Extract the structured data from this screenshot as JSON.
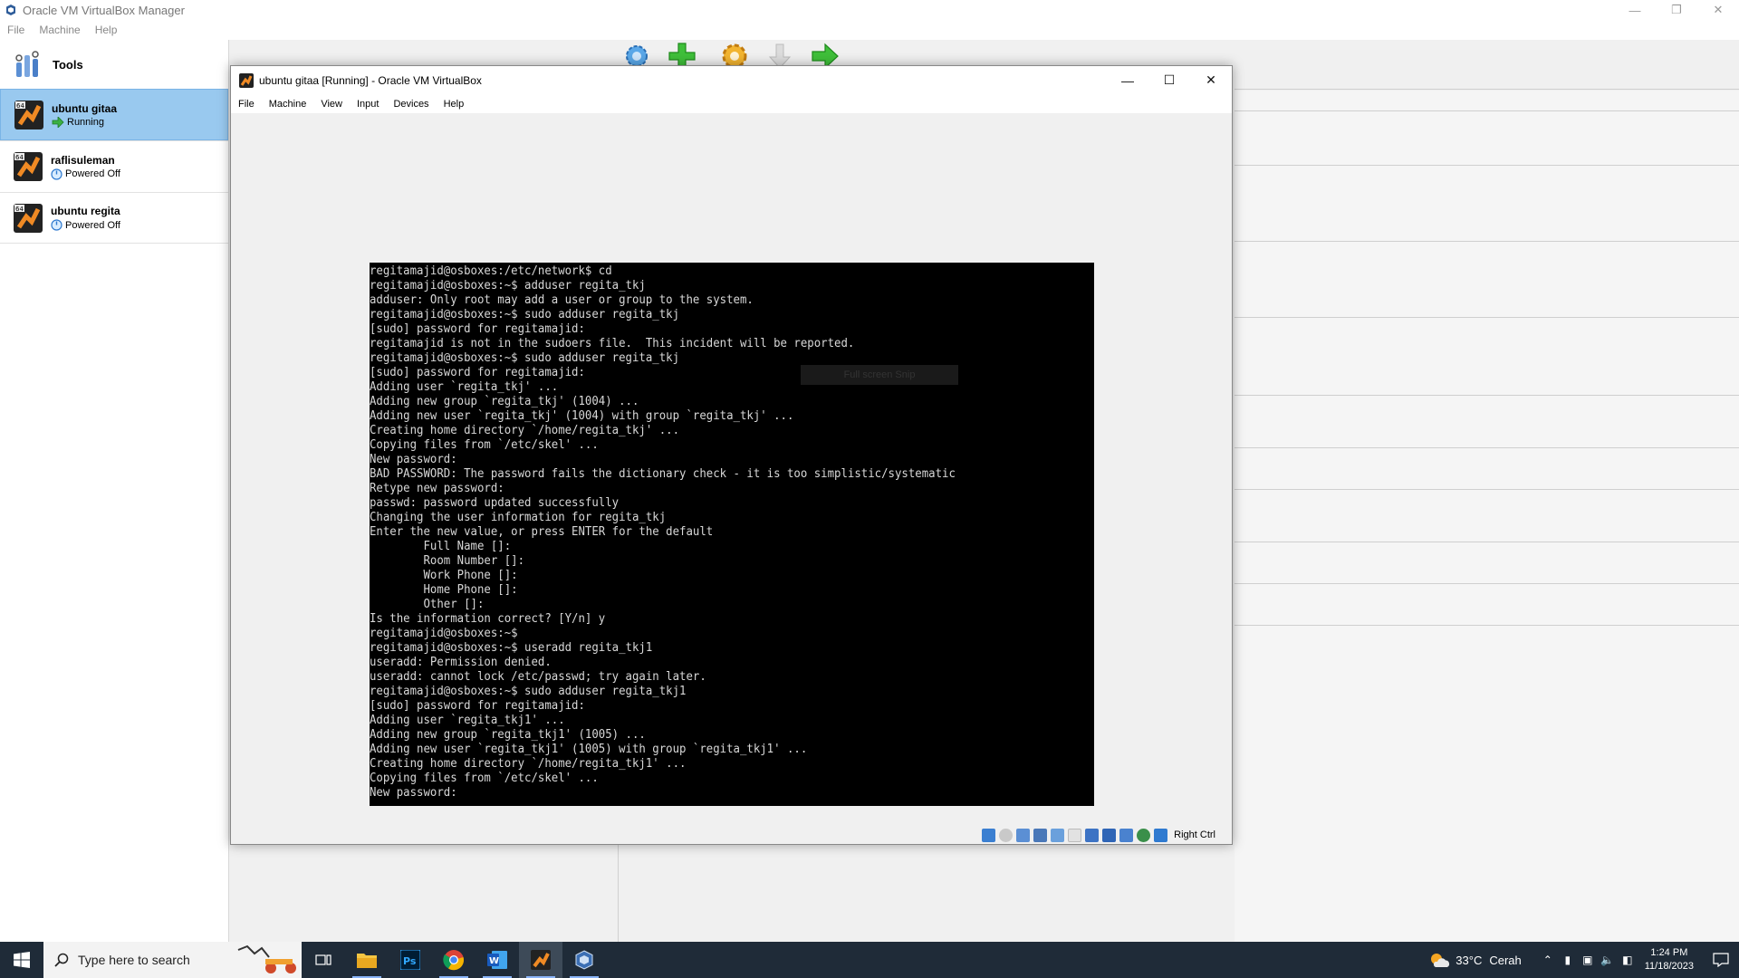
{
  "manager": {
    "title": "Oracle VM VirtualBox Manager",
    "menu": [
      "File",
      "Machine",
      "Help"
    ],
    "tools_label": "Tools",
    "vms": [
      {
        "name": "ubuntu gitaa",
        "state": "Running",
        "selected": true
      },
      {
        "name": "raflisuleman",
        "state": "Powered Off",
        "selected": false
      },
      {
        "name": "ubuntu regita",
        "state": "Powered Off",
        "selected": false
      }
    ],
    "toolbar_icons": [
      "preferences-icon",
      "new-vm-icon",
      "settings-icon",
      "discard-icon",
      "start-icon"
    ]
  },
  "vm_window": {
    "title": "ubuntu gitaa [Running] - Oracle VM VirtualBox",
    "menu": [
      "File",
      "Machine",
      "View",
      "Input",
      "Devices",
      "Help"
    ],
    "host_key": "Right Ctrl",
    "overlay_hint": "Full screen Snip",
    "terminal_lines": [
      "regitamajid@osboxes:/etc/network$ cd",
      "regitamajid@osboxes:~$ adduser regita_tkj",
      "adduser: Only root may add a user or group to the system.",
      "regitamajid@osboxes:~$ sudo adduser regita_tkj",
      "[sudo] password for regitamajid:",
      "regitamajid is not in the sudoers file.  This incident will be reported.",
      "regitamajid@osboxes:~$ sudo adduser regita_tkj",
      "[sudo] password for regitamajid:",
      "Adding user `regita_tkj' ...",
      "Adding new group `regita_tkj' (1004) ...",
      "Adding new user `regita_tkj' (1004) with group `regita_tkj' ...",
      "Creating home directory `/home/regita_tkj' ...",
      "Copying files from `/etc/skel' ...",
      "New password:",
      "BAD PASSWORD: The password fails the dictionary check - it is too simplistic/systematic",
      "Retype new password:",
      "passwd: password updated successfully",
      "Changing the user information for regita_tkj",
      "Enter the new value, or press ENTER for the default",
      "        Full Name []:",
      "        Room Number []:",
      "        Work Phone []:",
      "        Home Phone []:",
      "        Other []:",
      "Is the information correct? [Y/n] y",
      "regitamajid@osboxes:~$",
      "regitamajid@osboxes:~$ useradd regita_tkj1",
      "useradd: Permission denied.",
      "useradd: cannot lock /etc/passwd; try again later.",
      "regitamajid@osboxes:~$ sudo adduser regita_tkj1",
      "[sudo] password for regitamajid:",
      "Adding user `regita_tkj1' ...",
      "Adding new group `regita_tkj1' (1005) ...",
      "Adding new user `regita_tkj1' (1005) with group `regita_tkj1' ...",
      "Creating home directory `/home/regita_tkj1' ...",
      "Copying files from `/etc/skel' ...",
      "New password:"
    ]
  },
  "taskbar": {
    "search_placeholder": "Type here to search",
    "apps": [
      "task-view-icon",
      "file-explorer-icon",
      "photoshop-icon",
      "chrome-icon",
      "word-icon",
      "virtualbox-vm-icon",
      "virtualbox-icon"
    ],
    "weather_temp": "33°C",
    "weather_desc": "Cerah",
    "time": "1:24 PM",
    "date": "11/18/2023"
  },
  "colors": {
    "selection": "#99c9ef",
    "terminal_bg": "#000000",
    "terminal_fg": "#d8d8d8",
    "taskbar_bg": "#1f2b38"
  }
}
